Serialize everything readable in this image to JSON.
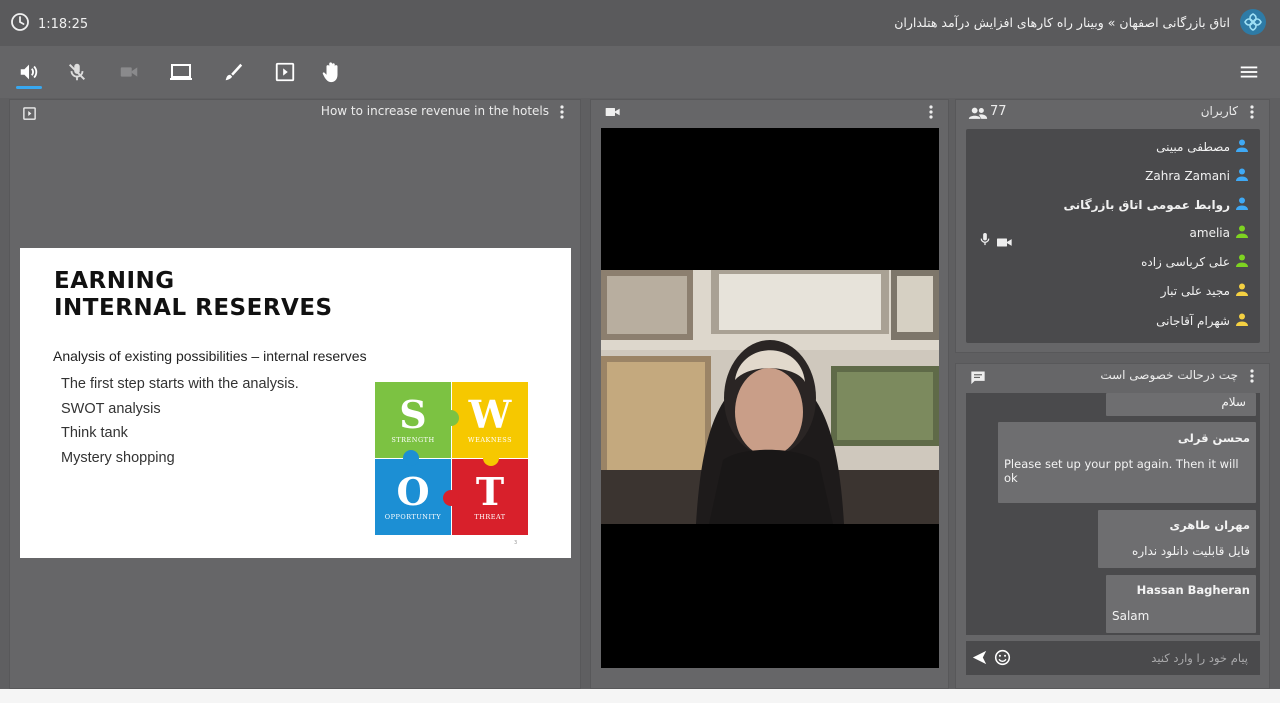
{
  "header": {
    "timer": "1:18:25",
    "breadcrumb": "اتاق بازرگانی اصفهان » وبینار راه کارهای افزایش درآمد هتلداران"
  },
  "toolbar": {
    "icons": [
      "speaker-icon",
      "mic-muted-icon",
      "camera-disabled-icon",
      "screen-share-icon",
      "brush-icon",
      "presentation-icon",
      "raise-hand-icon",
      "menu-icon"
    ]
  },
  "presentation": {
    "title": "How to increase revenue in the hotels",
    "slide": {
      "heading_line1": "EARNING",
      "heading_line2": "INTERNAL RESERVES",
      "subheading": "Analysis of existing possibilities – internal reserves",
      "items": [
        "The first step starts with the analysis.",
        "SWOT analysis",
        "Think tank",
        "Mystery shopping"
      ],
      "swot": {
        "s_letter": "S",
        "s_label": "STRENGTH",
        "w_letter": "W",
        "w_label": "WEAKNESS",
        "o_letter": "O",
        "o_label": "OPPORTUNITY",
        "t_letter": "T",
        "t_label": "THREAT"
      },
      "page_number": "3"
    }
  },
  "users": {
    "title": "کاربران",
    "count": "77",
    "list": [
      {
        "name": "مصطفی مبینی",
        "color": "#3fa9f5"
      },
      {
        "name": "Zahra Zamani",
        "color": "#3fa9f5"
      },
      {
        "name": "روابط عمومی اتاق بازرگانی",
        "color": "#3fa9f5"
      },
      {
        "name": "amelia",
        "color": "#7ed321"
      },
      {
        "name": "علی کرباسی زاده",
        "color": "#7ed321"
      },
      {
        "name": "مجید علی تبار",
        "color": "#f5d142"
      },
      {
        "name": "شهرام آقاجانی",
        "color": "#f5d142"
      }
    ]
  },
  "chat": {
    "title": "چت درحالت خصوصی است",
    "messages": [
      {
        "name": "",
        "text": "سلام"
      },
      {
        "name": "محسن قرلی",
        "text": "Please set up your ppt again. Then it will ok"
      },
      {
        "name": "مهران طاهری",
        "text": "فایل قابلیت دانلود نداره"
      },
      {
        "name": "Hassan Bagheran",
        "text": "Salam"
      }
    ],
    "input_placeholder": "پیام خود را وارد کنید"
  },
  "colors": {
    "accent": "#38a8f0",
    "panel": "#666668",
    "inner": "#4a4a4c"
  }
}
